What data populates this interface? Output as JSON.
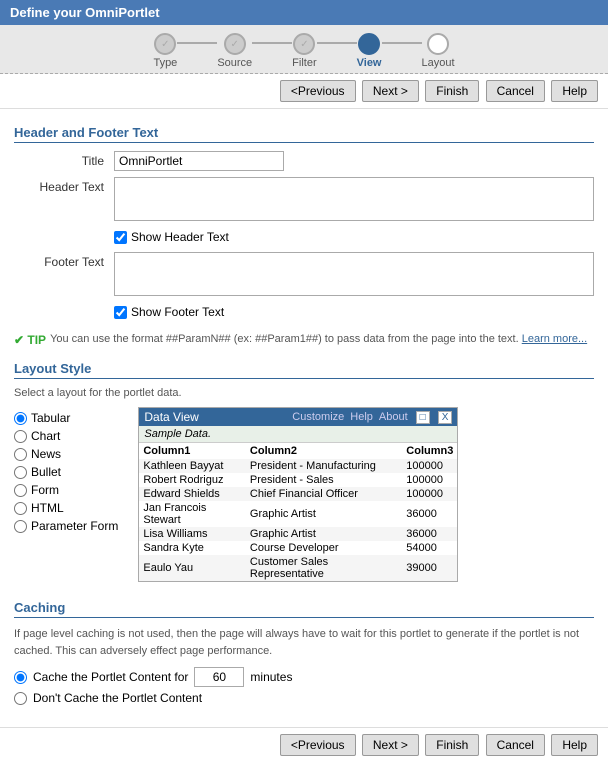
{
  "titlebar": {
    "label": "Define your OmniPortlet"
  },
  "wizard": {
    "steps": [
      {
        "id": "type",
        "label": "Type",
        "state": "completed"
      },
      {
        "id": "source",
        "label": "Source",
        "state": "completed"
      },
      {
        "id": "filter",
        "label": "Filter",
        "state": "completed"
      },
      {
        "id": "view",
        "label": "View",
        "state": "active"
      },
      {
        "id": "layout",
        "label": "Layout",
        "state": "inactive"
      }
    ]
  },
  "nav": {
    "previous": "<Previous",
    "next": "Next >",
    "finish": "Finish",
    "cancel": "Cancel",
    "help": "Help"
  },
  "header_footer": {
    "section_title": "Header and Footer Text",
    "title_label": "Title",
    "title_value": "OmniPortlet",
    "header_label": "Header Text",
    "header_value": "",
    "show_header_label": "Show Header Text",
    "footer_label": "Footer Text",
    "footer_value": "",
    "show_footer_label": "Show Footer Text"
  },
  "tip": {
    "icon": "✔ TIP",
    "text": "You can use the format ##ParamN## (ex: ##Param1##) to pass data from the page into the text.",
    "link_text": "Learn more..."
  },
  "layout_style": {
    "section_title": "Layout Style",
    "description": "Select a layout for the portlet data.",
    "options": [
      {
        "id": "tabular",
        "label": "Tabular",
        "checked": true
      },
      {
        "id": "chart",
        "label": "Chart",
        "checked": false
      },
      {
        "id": "news",
        "label": "News",
        "checked": false
      },
      {
        "id": "bullet",
        "label": "Bullet",
        "checked": false
      },
      {
        "id": "form",
        "label": "Form",
        "checked": false
      },
      {
        "id": "html",
        "label": "HTML",
        "checked": false
      },
      {
        "id": "parameter-form",
        "label": "Parameter Form",
        "checked": false
      }
    ],
    "preview": {
      "title": "Data View",
      "links": [
        "Customize",
        "Help",
        "About"
      ],
      "close_icon": "X",
      "sample_label": "Sample Data.",
      "columns": [
        "Column1",
        "Column2",
        "Column3"
      ],
      "rows": [
        [
          "Kathleen Bayyat",
          "President - Manufacturing",
          "100000"
        ],
        [
          "Robert Rodriguz",
          "President - Sales",
          "100000"
        ],
        [
          "Edward Shields",
          "Chief Financial Officer",
          "100000"
        ],
        [
          "Jan Francois Stewart",
          "Graphic Artist",
          "36000"
        ],
        [
          "Lisa Williams",
          "Graphic Artist",
          "36000"
        ],
        [
          "Sandra Kyte",
          "Course Developer",
          "54000"
        ],
        [
          "Eaulo Yau",
          "Customer Sales Representative",
          "39000"
        ]
      ]
    }
  },
  "caching": {
    "section_title": "Caching",
    "description": "If page level caching is not used, then the page will always have to wait for this portlet to generate if the portlet is not cached. This can adversely effect page performance.",
    "option1_label": "Cache the Portlet Content for",
    "minutes_value": "60",
    "minutes_label": "minutes",
    "option2_label": "Don't Cache the Portlet Content"
  }
}
